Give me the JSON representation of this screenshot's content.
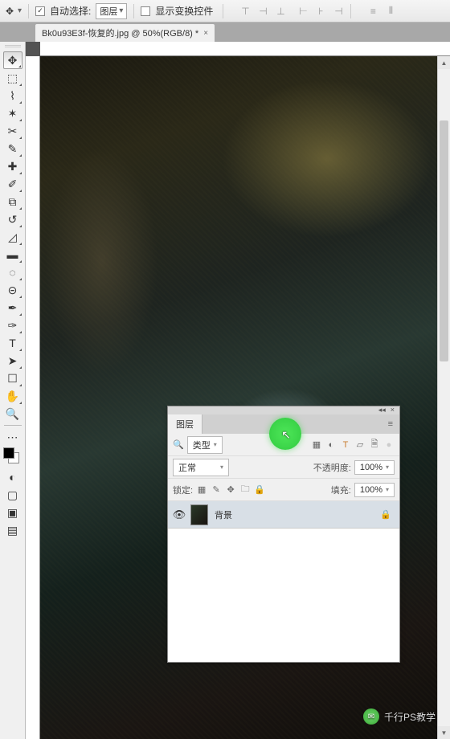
{
  "options": {
    "auto_select_label": "自动选择:",
    "auto_select_checked": "✓",
    "target_dropdown": "图层",
    "show_transform_label": "显示变换控件"
  },
  "tab": {
    "title": "Bk0u93E3f-恢复的.jpg @ 50%(RGB/8) *"
  },
  "tools": {
    "move": "✥",
    "marquee": "⬚",
    "lasso": "⌇",
    "wand": "✶",
    "crop": "✂",
    "eyedrop": "✎",
    "heal": "✚",
    "brush": "✐",
    "stamp": "⧉",
    "history": "↺",
    "eraser": "◿",
    "grad": "▬",
    "blur": "◌",
    "dodge": "⊝",
    "pen": "✒",
    "pen2": "✑",
    "type": "T",
    "path": "➤",
    "shape": "☐",
    "hand": "✋",
    "zoom": "🔍",
    "mask": "◐",
    "screen1": "▢",
    "screen2": "▣",
    "screen3": "▤"
  },
  "layers_panel": {
    "title": "图层",
    "filter_label": "类型",
    "blend_mode": "正常",
    "opacity_label": "不透明度:",
    "opacity_value": "100%",
    "lock_label": "锁定:",
    "fill_label": "填充:",
    "fill_value": "100%",
    "layer_name": "背景",
    "icons": {
      "img": "▦",
      "adj": "◐",
      "type": "T",
      "shape": "▱",
      "smart": "🗎",
      "dot": "●"
    },
    "lock_icons": {
      "img": "▦",
      "brush": "✎",
      "move": "✥",
      "lock": "🔒",
      "art": "🗀"
    }
  },
  "watermark": {
    "text": "千行PS教学"
  }
}
